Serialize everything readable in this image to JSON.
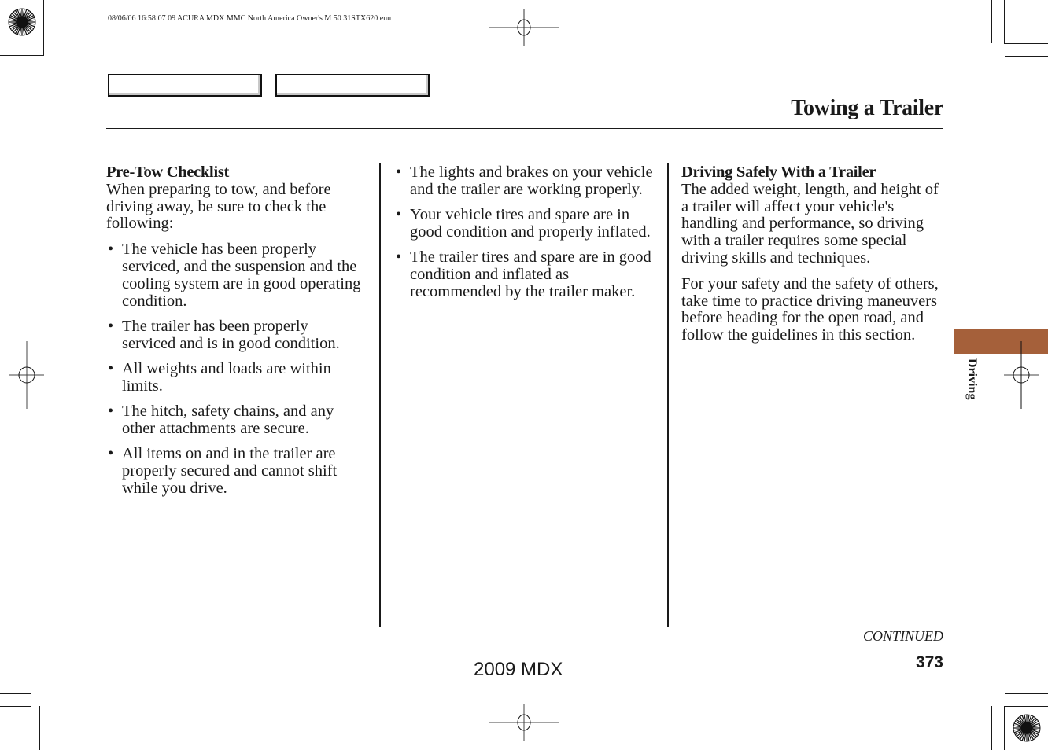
{
  "print_slug": "08/06/06 16:58:07    09 ACURA MDX MMC North America Owner's M 50 31STX620 enu",
  "nav_boxes": [
    {
      "label": ""
    },
    {
      "label": ""
    }
  ],
  "page_title": "Towing a Trailer",
  "section_tab": {
    "label": "Driving",
    "color": "#a5603a"
  },
  "column1": {
    "heading": "Pre-Tow Checklist",
    "intro": "When preparing to tow, and before driving away, be sure to check the following:",
    "bullets": [
      "The vehicle has been properly serviced, and the suspension and the cooling system are in good operating condition.",
      "The trailer has been properly serviced and is in good condition.",
      "All weights and loads are within limits.",
      "The hitch, safety chains, and any other attachments are secure.",
      "All items on and in the trailer are properly secured and cannot shift while you drive."
    ]
  },
  "column2": {
    "bullets": [
      "The lights and brakes on your vehicle and the trailer are working properly.",
      "Your vehicle tires and spare are in good condition and properly inflated.",
      "The trailer tires and spare are in good condition and inflated as recommended by the trailer maker."
    ]
  },
  "column3": {
    "heading": "Driving Safely With a Trailer",
    "paragraphs": [
      "The added weight, length, and height of a trailer will affect your vehicle's handling and performance, so driving with a trailer requires some special driving skills and techniques.",
      "For your safety and the safety of others, take time to practice driving maneuvers before heading for the open road, and follow the guidelines in this section."
    ]
  },
  "bullet_glyph": "•",
  "continued_label": "CONTINUED",
  "page_number": "373",
  "model_label": "2009  MDX"
}
